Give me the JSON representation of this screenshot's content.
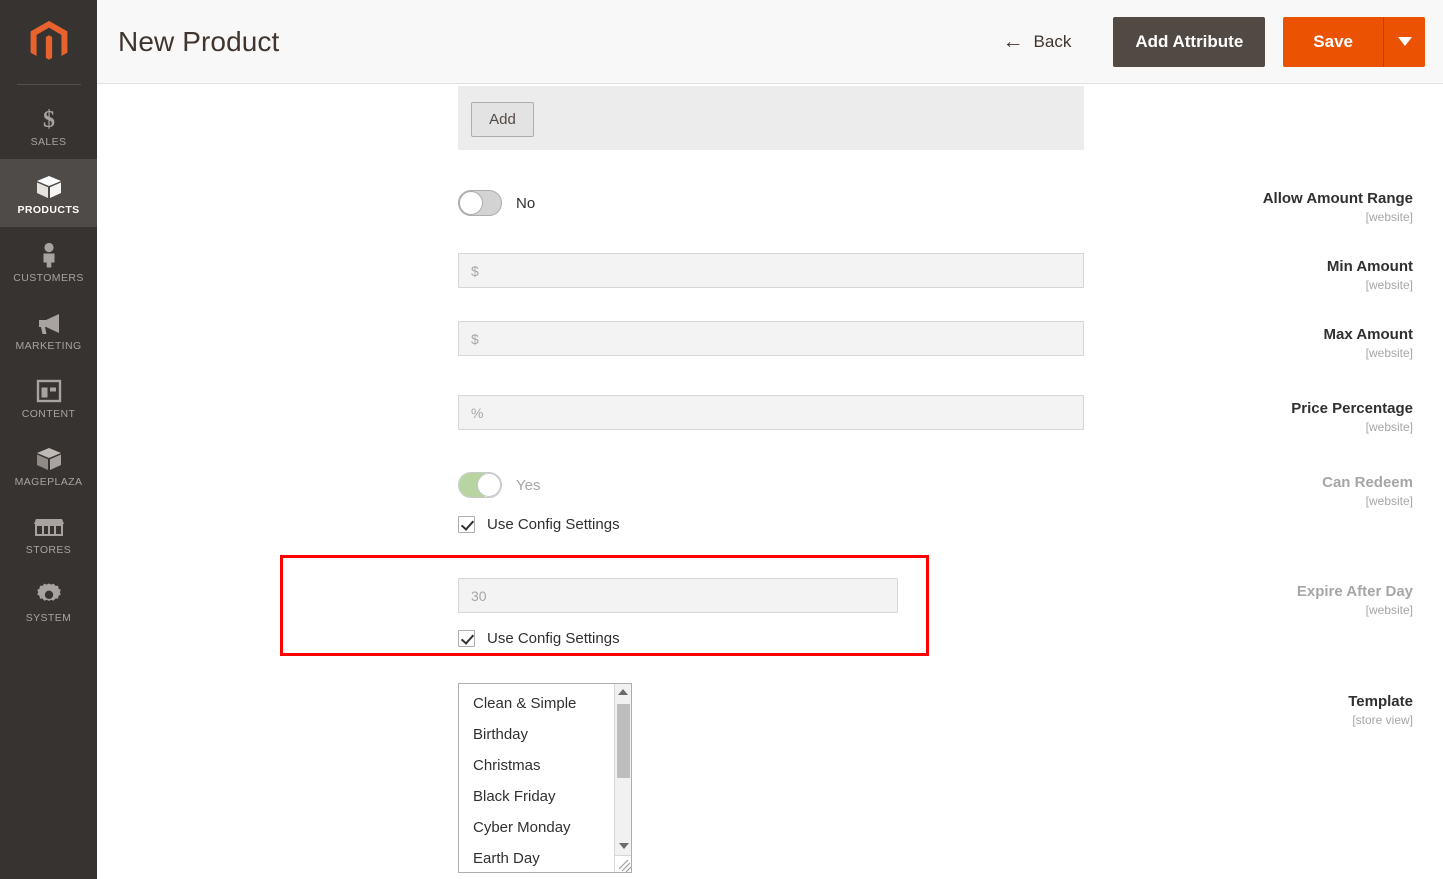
{
  "sidebar": {
    "logo_icon": "magento-logo-icon",
    "items": [
      {
        "label": "SALES",
        "icon": "dollar-icon",
        "active": false
      },
      {
        "label": "PRODUCTS",
        "icon": "box-icon",
        "active": true
      },
      {
        "label": "CUSTOMERS",
        "icon": "person-icon",
        "active": false
      },
      {
        "label": "MARKETING",
        "icon": "megaphone-icon",
        "active": false
      },
      {
        "label": "CONTENT",
        "icon": "layout-icon",
        "active": false
      },
      {
        "label": "MAGEPLAZA",
        "icon": "box-icon",
        "active": false
      },
      {
        "label": "STORES",
        "icon": "storefront-icon",
        "active": false
      },
      {
        "label": "SYSTEM",
        "icon": "gear-icon",
        "active": false
      }
    ]
  },
  "header": {
    "title": "New Product",
    "back_label": "Back",
    "add_attribute_label": "Add Attribute",
    "save_label": "Save",
    "save_caret_icon": "chevron-down-icon",
    "back_icon": "arrow-left-icon",
    "accent_color": "#eb5202",
    "dark_button_color": "#514943"
  },
  "form": {
    "add_button_label": "Add",
    "rows": [
      {
        "label": "Allow Amount Range",
        "scope": "[website]",
        "type": "toggle",
        "toggle_state": "off",
        "toggle_text": "No",
        "disabled": false
      },
      {
        "label": "Min Amount",
        "scope": "[website]",
        "type": "input",
        "value": "",
        "placeholder": "$",
        "disabled": true
      },
      {
        "label": "Max Amount",
        "scope": "[website]",
        "type": "input",
        "value": "",
        "placeholder": "$",
        "disabled": true
      },
      {
        "label": "Price Percentage",
        "scope": "[website]",
        "type": "input",
        "value": "",
        "placeholder": "%",
        "disabled": true
      },
      {
        "label": "Can Redeem",
        "scope": "[website]",
        "type": "toggle",
        "toggle_state": "on",
        "toggle_text": "Yes",
        "disabled": true,
        "checkbox_label": "Use Config Settings",
        "checkbox_checked": true
      },
      {
        "label": "Expire After Day",
        "scope": "[website]",
        "type": "input",
        "value": "",
        "placeholder": "30",
        "disabled": true,
        "checkbox_label": "Use Config Settings",
        "checkbox_checked": true,
        "highlighted": true
      },
      {
        "label": "Template",
        "scope": "[store view]",
        "type": "listbox"
      }
    ],
    "template_options": [
      "Clean & Simple",
      "Birthday",
      "Christmas",
      "Black Friday",
      "Cyber Monday",
      "Earth Day"
    ],
    "highlight_color": "#ff0000"
  }
}
